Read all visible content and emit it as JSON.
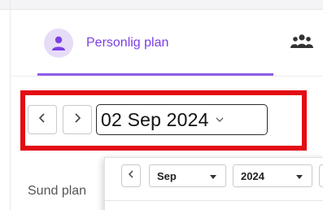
{
  "tabs": {
    "personal": {
      "label": "Personlig plan",
      "icon": "person-icon",
      "active": true
    },
    "group": {
      "icon": "group-icon"
    }
  },
  "date_picker": {
    "prev_icon": "chevron-left-icon",
    "next_icon": "chevron-right-icon",
    "selected_date": "02 Sep 2024",
    "dropdown_icon": "chevron-down-icon"
  },
  "section": {
    "label": "Sund plan"
  },
  "calendar_popup": {
    "month_value": "Sep",
    "year_value": "2024"
  },
  "colors": {
    "accent": "#7b3fe4",
    "highlight": "#e30d13"
  }
}
